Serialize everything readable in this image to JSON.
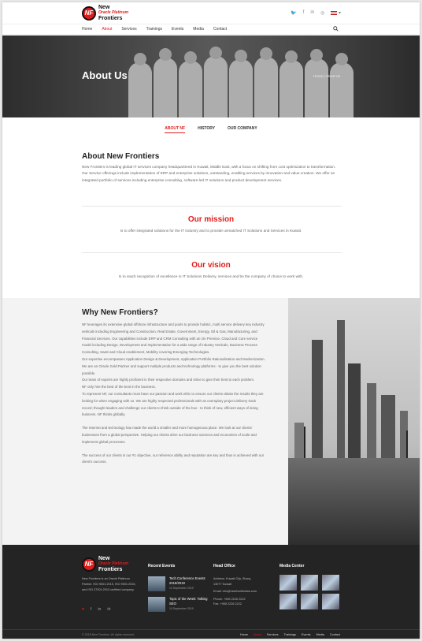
{
  "brand": {
    "logo_mark": "NF",
    "name_line1": "New",
    "name_line2": "Frontiers",
    "tagline": "Oracle Platinum",
    "accent": "#e21b1b"
  },
  "header": {
    "social": [
      "twitter-icon",
      "facebook-icon",
      "linkedin-icon",
      "instagram-icon"
    ],
    "social_glyphs": [
      "🐦",
      "f",
      "in",
      "◎"
    ],
    "language_caret": "▾"
  },
  "nav": {
    "items": [
      {
        "label": "Home",
        "active": false
      },
      {
        "label": "About",
        "active": true
      },
      {
        "label": "Services",
        "active": false
      },
      {
        "label": "Trainings",
        "active": false
      },
      {
        "label": "Events",
        "active": false
      },
      {
        "label": "Media",
        "active": false
      },
      {
        "label": "Contact",
        "active": false
      }
    ]
  },
  "hero": {
    "title": "About Us",
    "breadcrumb": "Home | About Us"
  },
  "tabs": [
    "ABOUT NF",
    "HISTORY",
    "OUR COMPANY"
  ],
  "about": {
    "heading": "About New Frontiers",
    "body": "New Frontiers is leading global IT services company headquartered in Kuwait, Middle East, with a focus on shifting from cost optimization to transformation. Our Service offerings include implementation of ERP and enterprise solutions, outstanding, enabling services by innovation and value creation. We offer an integrated portfolio of services including enterprise consulting, software-led IT solutions and product development services."
  },
  "mission": {
    "heading": "Our mission",
    "body": "Is to offer integrated solutions for the IT industry and to provide unmatched IT Solutions and Services in Kuwait."
  },
  "vision": {
    "heading": "Our vision",
    "body": "Is to reach recognition of excellence in IT Solutions Delivery, services and be the company of choice to work with."
  },
  "why": {
    "heading": "Why New Frontiers?",
    "paragraphs": [
      "NF leverages its extensive global offshore infrastructure and pools to provide holistic, multi service delivery key industry verticals including Engineering and Construction, Real Estate, Government, Energy, Oil & Gas, Manufacturing, and Financial Services. Our capabilities include ERP and CRM Consulting with an On Premise, Cloud and Core service model including Design, Development and Implementation for a wide range of industry Verticals, Business Process Consulting, SaaS and Cloud enablement, Mobility covering Emerging Technologies.",
      "Our expertise encompasses Application Design & Development, Application Portfolio Rationalization and Modernization.",
      "We are an Oracle Gold Partner and support multiple products and technology platforms - to give you the best solution possible.",
      "Our team of experts are highly proficient in their respective domains and strive to give their best to each problem.",
      "NF only hire the best of the best in the business.",
      "To represent NF, our consultants must have our passion and work ethic to ensure our clients obtain the results they are looking for when engaging with us. We are highly respected professionals with an exemplary project delivery track record; thought leaders and challenge our clients to think outside of the box - to think of new, efficient ways of doing business. NF thinks globally.",
      "The Internet and technology has made the world a smaller and more homogenous place. We look at our clients' businesses from a global perspective. Helping our clients drive our business sciences and economies of scale and implement global processes.",
      "The success of our clients is our #1 objective, our reference ability and reputation are key and thus is achieved with our client's success."
    ]
  },
  "footer": {
    "about": "New Frontiers is an Oracle Platinum Partner. ISO 9001:2015, ISO 9001:2015, and ISO 27001:2013 certified company.",
    "social": [
      "heart-icon",
      "facebook-icon",
      "linkedin-icon",
      "mail-icon"
    ],
    "social_glyphs": [
      "♥",
      "f",
      "in",
      "✉"
    ],
    "events_heading": "Recent Events",
    "events": [
      {
        "title": "Tech Conference Events 2018/2019",
        "date": "10 September 2019"
      },
      {
        "title": "Topic of the Week: Talking SEO",
        "date": "10 September 2019"
      }
    ],
    "office_heading": "Head Office",
    "office_lines": [
      "Address: Kuwait City, Sharq,",
      "13077 Kuwait",
      "Email: info@newfrontierskw.com",
      "Phone: +965 2226 2222",
      "Fax: +965 2226 2222"
    ],
    "media_heading": "Media Center",
    "copyright": "© 2018 New Frontiers. All rights reserved.",
    "nav": [
      {
        "label": "Home",
        "active": false
      },
      {
        "label": "About",
        "active": true
      },
      {
        "label": "Services",
        "active": false
      },
      {
        "label": "Trainings",
        "active": false
      },
      {
        "label": "Events",
        "active": false
      },
      {
        "label": "Media",
        "active": false
      },
      {
        "label": "Contact",
        "active": false
      }
    ]
  }
}
